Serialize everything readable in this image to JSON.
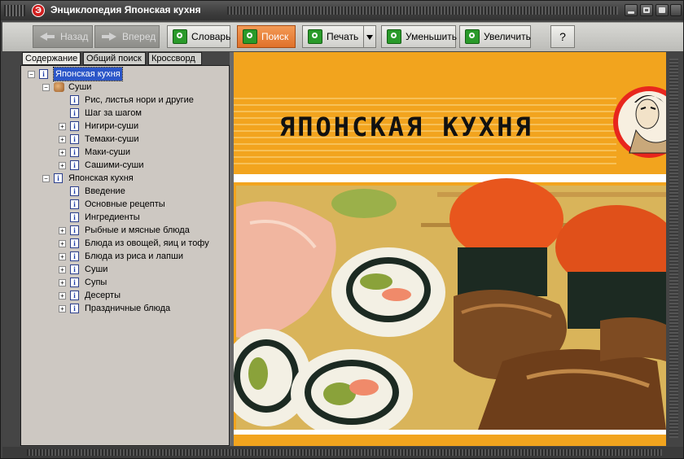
{
  "app": {
    "title": "Энциклопедия Японская кухня",
    "icon_glyph": "Э"
  },
  "toolbar": {
    "buttons": [
      {
        "id": "back",
        "label": "Назад",
        "icon": "back-arrow-icon",
        "state": "disabled"
      },
      {
        "id": "forward",
        "label": "Вперед",
        "icon": "forward-arrow-icon",
        "state": "disabled"
      },
      {
        "id": "dictionary",
        "label": "Словарь",
        "icon": "book-green-icon",
        "state": "normal"
      },
      {
        "id": "search",
        "label": "Поиск",
        "icon": "magnifier-green-icon",
        "state": "active"
      },
      {
        "id": "print",
        "label": "Печать",
        "icon": "printer-green-icon",
        "state": "normal"
      },
      {
        "id": "zoom_out",
        "label": "Уменьшить",
        "icon": "zoom-out-green-icon",
        "state": "normal"
      },
      {
        "id": "zoom_in",
        "label": "Увеличить",
        "icon": "zoom-in-green-icon",
        "state": "normal"
      },
      {
        "id": "help",
        "label": "?",
        "icon": "",
        "state": "normal"
      }
    ]
  },
  "tabs": [
    {
      "label": "Содержание",
      "active": true
    },
    {
      "label": "Общий поиск",
      "active": false
    },
    {
      "label": "Кроссворд",
      "active": false
    }
  ],
  "tree": [
    {
      "label": "Японская кухня",
      "level": 0,
      "expander": "minus",
      "icon": "info",
      "selected": true
    },
    {
      "label": "Суши",
      "level": 1,
      "expander": "minus",
      "icon": "book",
      "selected": false
    },
    {
      "label": "Рис, листья нори и другие",
      "level": 2,
      "expander": "none",
      "icon": "info",
      "selected": false
    },
    {
      "label": "Шаг за шагом",
      "level": 2,
      "expander": "none",
      "icon": "info",
      "selected": false
    },
    {
      "label": "Нигири-суши",
      "level": 2,
      "expander": "plus",
      "icon": "info",
      "selected": false
    },
    {
      "label": "Темаки-суши",
      "level": 2,
      "expander": "plus",
      "icon": "info",
      "selected": false
    },
    {
      "label": "Маки-суши",
      "level": 2,
      "expander": "plus",
      "icon": "info",
      "selected": false
    },
    {
      "label": "Сашими-суши",
      "level": 2,
      "expander": "plus",
      "icon": "info",
      "selected": false
    },
    {
      "label": "Японская кухня",
      "level": 1,
      "expander": "minus",
      "icon": "info",
      "selected": false
    },
    {
      "label": "Введение",
      "level": 2,
      "expander": "none",
      "icon": "info",
      "selected": false
    },
    {
      "label": "Основные рецепты",
      "level": 2,
      "expander": "none",
      "icon": "info",
      "selected": false
    },
    {
      "label": "Ингредиенты",
      "level": 2,
      "expander": "none",
      "icon": "info",
      "selected": false
    },
    {
      "label": "Рыбные и мясные блюда",
      "level": 2,
      "expander": "plus",
      "icon": "info",
      "selected": false
    },
    {
      "label": "Блюда из овощей, яиц и тофу",
      "level": 2,
      "expander": "plus",
      "icon": "info",
      "selected": false
    },
    {
      "label": "Блюда из риса и лапши",
      "level": 2,
      "expander": "plus",
      "icon": "info",
      "selected": false
    },
    {
      "label": "Суши",
      "level": 2,
      "expander": "plus",
      "icon": "info",
      "selected": false
    },
    {
      "label": "Супы",
      "level": 2,
      "expander": "plus",
      "icon": "info",
      "selected": false
    },
    {
      "label": "Десерты",
      "level": 2,
      "expander": "plus",
      "icon": "info",
      "selected": false
    },
    {
      "label": "Праздничные блюда",
      "level": 2,
      "expander": "plus",
      "icon": "info",
      "selected": false
    }
  ],
  "content": {
    "banner_title": "ЯПОНСКАЯ КУХНЯ",
    "colors": {
      "banner_orange": "#f2a41e",
      "stripe_light": "#f7c158",
      "salmon_roe": "#e8561d",
      "rice": "#f3f0e4",
      "nori": "#1c2a22"
    }
  }
}
